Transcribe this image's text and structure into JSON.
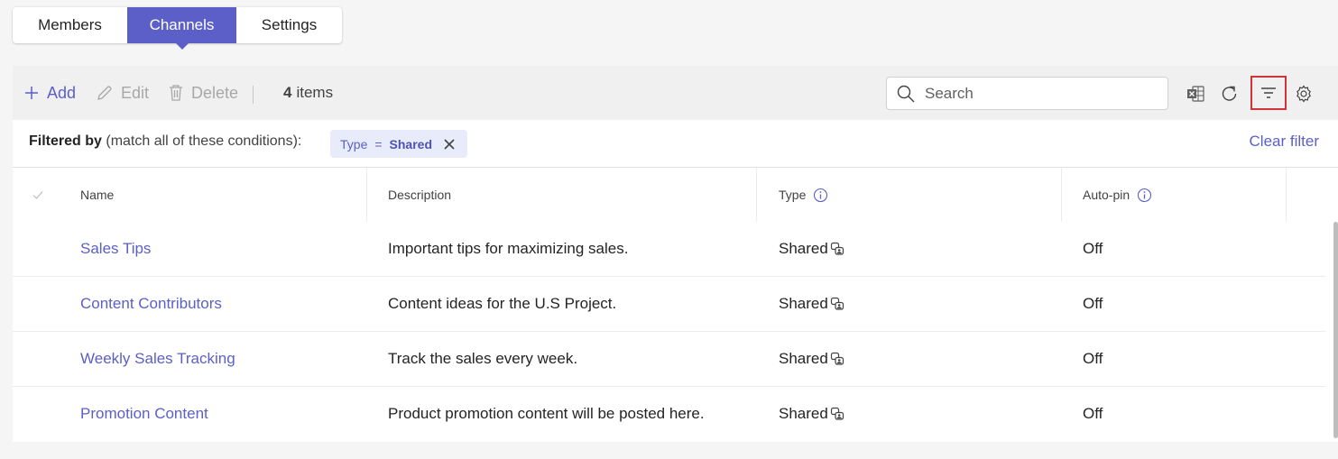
{
  "tabs": [
    {
      "label": "Members",
      "selected": false
    },
    {
      "label": "Channels",
      "selected": true
    },
    {
      "label": "Settings",
      "selected": false
    }
  ],
  "toolbar": {
    "add_label": "Add",
    "edit_label": "Edit",
    "delete_label": "Delete",
    "item_count": "4",
    "item_count_suffix": "items",
    "search_placeholder": "Search"
  },
  "filter": {
    "label_bold": "Filtered by",
    "label_rest": "(match all of these conditions):",
    "chip_field": "Type",
    "chip_operator": "=",
    "chip_value": "Shared",
    "clear_label": "Clear filter"
  },
  "table": {
    "columns": [
      "Name",
      "Description",
      "Type",
      "Auto-pin"
    ],
    "rows": [
      {
        "name": "Sales Tips",
        "description": "Important tips for maximizing sales.",
        "type": "Shared",
        "autopin": "Off"
      },
      {
        "name": "Content Contributors",
        "description": "Content ideas for the U.S Project.",
        "type": "Shared",
        "autopin": "Off"
      },
      {
        "name": "Weekly Sales Tracking",
        "description": "Track the sales every week.",
        "type": "Shared",
        "autopin": "Off"
      },
      {
        "name": "Promotion Content",
        "description": "Product promotion content will be posted here.",
        "type": "Shared",
        "autopin": "Off"
      }
    ]
  },
  "colors": {
    "accent": "#5b5fc7",
    "highlight_border": "#d13438",
    "chip_bg": "#e8ebfa"
  },
  "icons": [
    "add-icon",
    "edit-icon",
    "delete-icon",
    "search-icon",
    "excel-icon",
    "refresh-icon",
    "filter-icon",
    "gear-icon",
    "close-icon",
    "info-icon",
    "shared-channel-icon",
    "check-icon"
  ]
}
